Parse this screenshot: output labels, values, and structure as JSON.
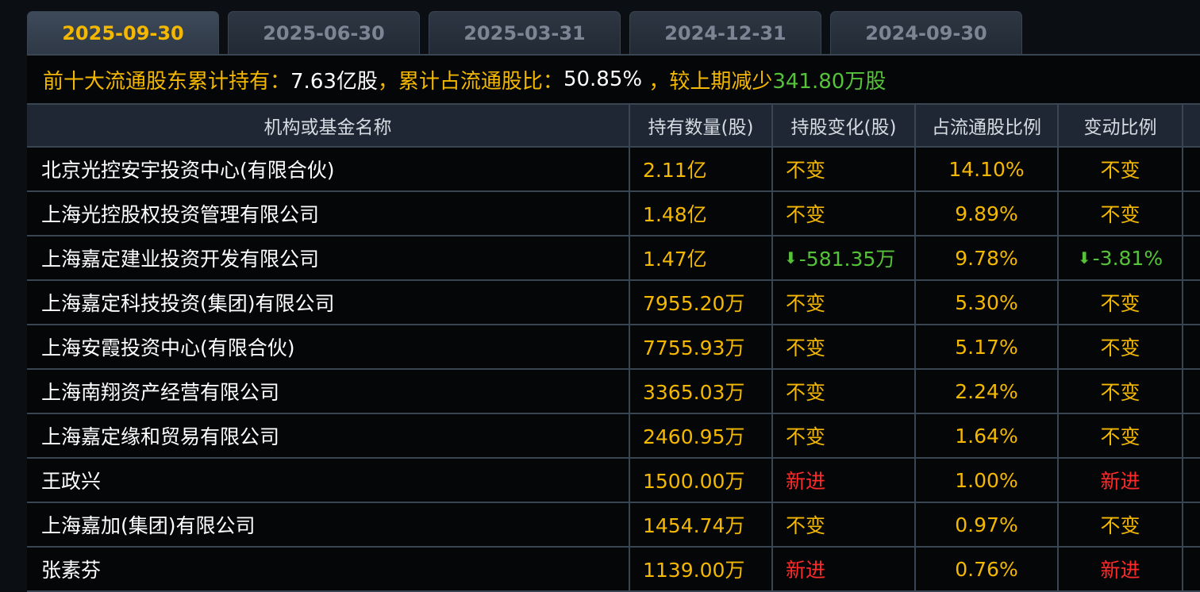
{
  "tabs": [
    {
      "label": "2025-09-30",
      "active": true
    },
    {
      "label": "2025-06-30",
      "active": false
    },
    {
      "label": "2025-03-31",
      "active": false
    },
    {
      "label": "2024-12-31",
      "active": false
    },
    {
      "label": "2024-09-30",
      "active": false
    }
  ],
  "summary": {
    "prefix": "前十大流通股东累计持有：",
    "holding": "7.63亿股",
    "mid_sep": "，累计占流通股比：",
    "ratio": "50.85%",
    "change_sep": " ，较上期减少",
    "change": "341.80万股"
  },
  "columns": [
    "机构或基金名称",
    "持有数量(股)",
    "持股变化(股)",
    "占流通股比例",
    "变动比例"
  ],
  "rows": [
    {
      "name": "北京光控安宇投资中心(有限合伙)",
      "qty": "2.11亿",
      "change": "不变",
      "change_type": "same",
      "ratio": "14.10%",
      "change_ratio": "不变"
    },
    {
      "name": "上海光控股权投资管理有限公司",
      "qty": "1.48亿",
      "change": "不变",
      "change_type": "same",
      "ratio": "9.89%",
      "change_ratio": "不变"
    },
    {
      "name": "上海嘉定建业投资开发有限公司",
      "qty": "1.47亿",
      "change": "-581.35万",
      "change_type": "down",
      "ratio": "9.78%",
      "change_ratio": "-3.81%"
    },
    {
      "name": "上海嘉定科技投资(集团)有限公司",
      "qty": "7955.20万",
      "change": "不变",
      "change_type": "same",
      "ratio": "5.30%",
      "change_ratio": "不变"
    },
    {
      "name": "上海安霞投资中心(有限合伙)",
      "qty": "7755.93万",
      "change": "不变",
      "change_type": "same",
      "ratio": "5.17%",
      "change_ratio": "不变"
    },
    {
      "name": "上海南翔资产经营有限公司",
      "qty": "3365.03万",
      "change": "不变",
      "change_type": "same",
      "ratio": "2.24%",
      "change_ratio": "不变"
    },
    {
      "name": "上海嘉定缘和贸易有限公司",
      "qty": "2460.95万",
      "change": "不变",
      "change_type": "same",
      "ratio": "1.64%",
      "change_ratio": "不变"
    },
    {
      "name": "王政兴",
      "qty": "1500.00万",
      "change": "新进",
      "change_type": "new",
      "ratio": "1.00%",
      "change_ratio": "新进"
    },
    {
      "name": "上海嘉加(集团)有限公司",
      "qty": "1454.74万",
      "change": "不变",
      "change_type": "same",
      "ratio": "0.97%",
      "change_ratio": "不变"
    },
    {
      "name": "张素芬",
      "qty": "1139.00万",
      "change": "新进",
      "change_type": "new",
      "ratio": "0.76%",
      "change_ratio": "新进"
    }
  ],
  "colors": {
    "accent": "#f5b800",
    "down": "#55c23a",
    "new": "#ff2a2a",
    "text": "#ffffff"
  },
  "icons": {
    "down": "down-arrow-icon"
  }
}
